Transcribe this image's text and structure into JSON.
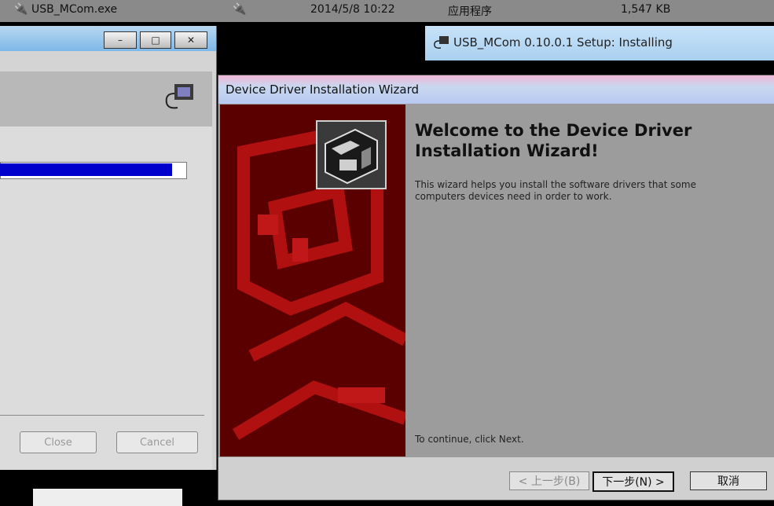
{
  "background_row": {
    "name": "USB_MCom.exe",
    "date": "2014/5/8 10:22",
    "type": "应用程序",
    "size": "1,547 KB"
  },
  "left_window": {
    "minimize": "–",
    "maximize": "□",
    "close": "✕",
    "progress_percent": 92,
    "close_button": "Close",
    "cancel_button": "Cancel",
    "icon": "usb-plug-icon"
  },
  "setup_window": {
    "title": "USB_MCom 0.10.0.1 Setup: Installing",
    "icon": "usb-plug-icon"
  },
  "wizard": {
    "title": "Device Driver Installation Wizard",
    "heading": "Welcome to the Device Driver Installation Wizard!",
    "body": "This wizard helps you install the software drivers that some computers devices need in order to work.",
    "continue": "To continue, click Next.",
    "back_button": "< 上一步(B)",
    "next_button": "下一步(N) >",
    "cancel_button": "取消",
    "icon": "hardware-box-icon"
  },
  "colors": {
    "progress": "#0000cc",
    "banner": "#5a0000"
  }
}
